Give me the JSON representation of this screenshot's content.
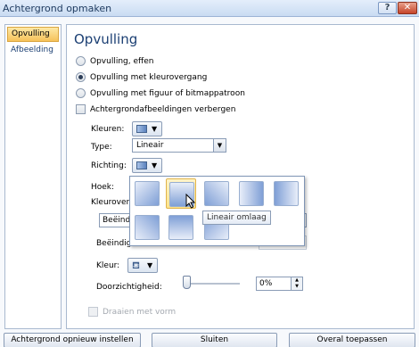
{
  "window": {
    "title": "Achtergrond opmaken",
    "help_label": "?",
    "close_label": "✕"
  },
  "nav": {
    "items": [
      {
        "label": "Opvulling",
        "active": true
      },
      {
        "label": "Afbeelding",
        "active": false
      }
    ]
  },
  "fill": {
    "title": "Opvulling",
    "options": [
      {
        "label": "Opvulling, effen",
        "checked": false
      },
      {
        "label": "Opvulling met kleurovergang",
        "checked": true
      },
      {
        "label": "Opvulling met figuur of bitmappatroon",
        "checked": false
      }
    ],
    "hide_background_label": "Achtergrondafbeeldingen verbergen",
    "hide_background_checked": false
  },
  "gradient": {
    "colors_label": "Kleuren:",
    "type_label": "Type:",
    "type_value": "Lineair",
    "direction_label": "Richting:",
    "angle_label": "Hoek:",
    "stops_label": "Kleurovergang",
    "stop_value": "Beëind",
    "end_position_label": "Beëindig",
    "color_label": "Kleur:",
    "transparency_label": "Doorzichtigheid:",
    "transparency_value": "0%",
    "transparency_fraction": 0.0,
    "rotate_label": "Draaien met vorm",
    "rotate_checked": false
  },
  "gallery": {
    "tooltip": "Lineair omlaag"
  },
  "buttons": {
    "reset": "Achtergrond opnieuw instellen",
    "close": "Sluiten",
    "apply_all": "Overal toepassen"
  },
  "colors": {
    "accent": "#f6c25a",
    "gradient_light": "#e8eef9",
    "gradient_dark": "#7f9fd6"
  }
}
